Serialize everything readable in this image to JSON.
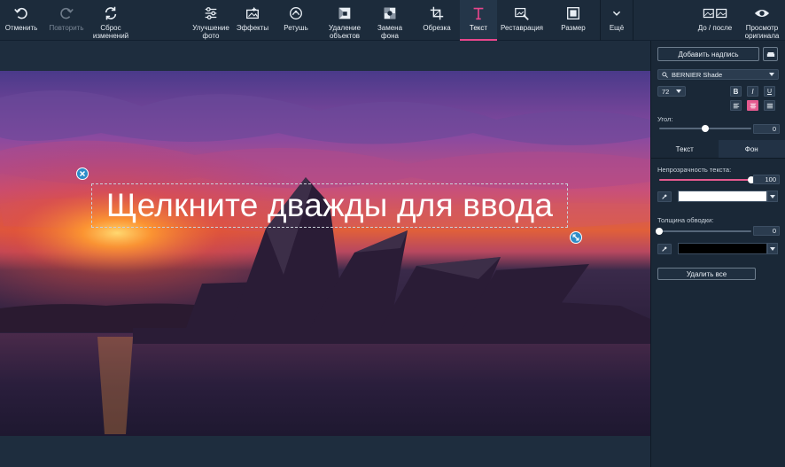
{
  "toolbar": {
    "undo": "Отменить",
    "redo": "Повторить",
    "reset": "Сброс изменений",
    "enhance": "Улучшение фото",
    "effects": "Эффекты",
    "retouch": "Ретушь",
    "remove_objects": "Удаление объектов",
    "replace_bg": "Замена фона",
    "crop": "Обрезка",
    "text": "Текст",
    "restore": "Реставрация",
    "resize": "Размер",
    "more": "Ещё",
    "before_after": "До / после",
    "preview": "Просмотр оригинала"
  },
  "canvas": {
    "overlay_text": "Щелкните дважды для ввода"
  },
  "panel": {
    "add_caption": "Добавить надпись",
    "font_name": "BERNIER Shade",
    "font_size": "72",
    "bold": "B",
    "italic": "I",
    "underline": "U",
    "angle_label": "Угол:",
    "angle_value": "0",
    "angle_level": 0.5,
    "tab_text": "Текст",
    "tab_bg": "Фон",
    "opacity_label": "Непрозрачность текста:",
    "opacity_value": "100",
    "opacity_level": 1.0,
    "text_color": "#ffffff",
    "stroke_label": "Толщина обводки:",
    "stroke_value": "0",
    "stroke_level": 0.0,
    "stroke_color": "#000000",
    "delete_all": "Удалить все"
  },
  "colors": {
    "accent": "#e55a8f",
    "handle": "#2d8cc8"
  }
}
